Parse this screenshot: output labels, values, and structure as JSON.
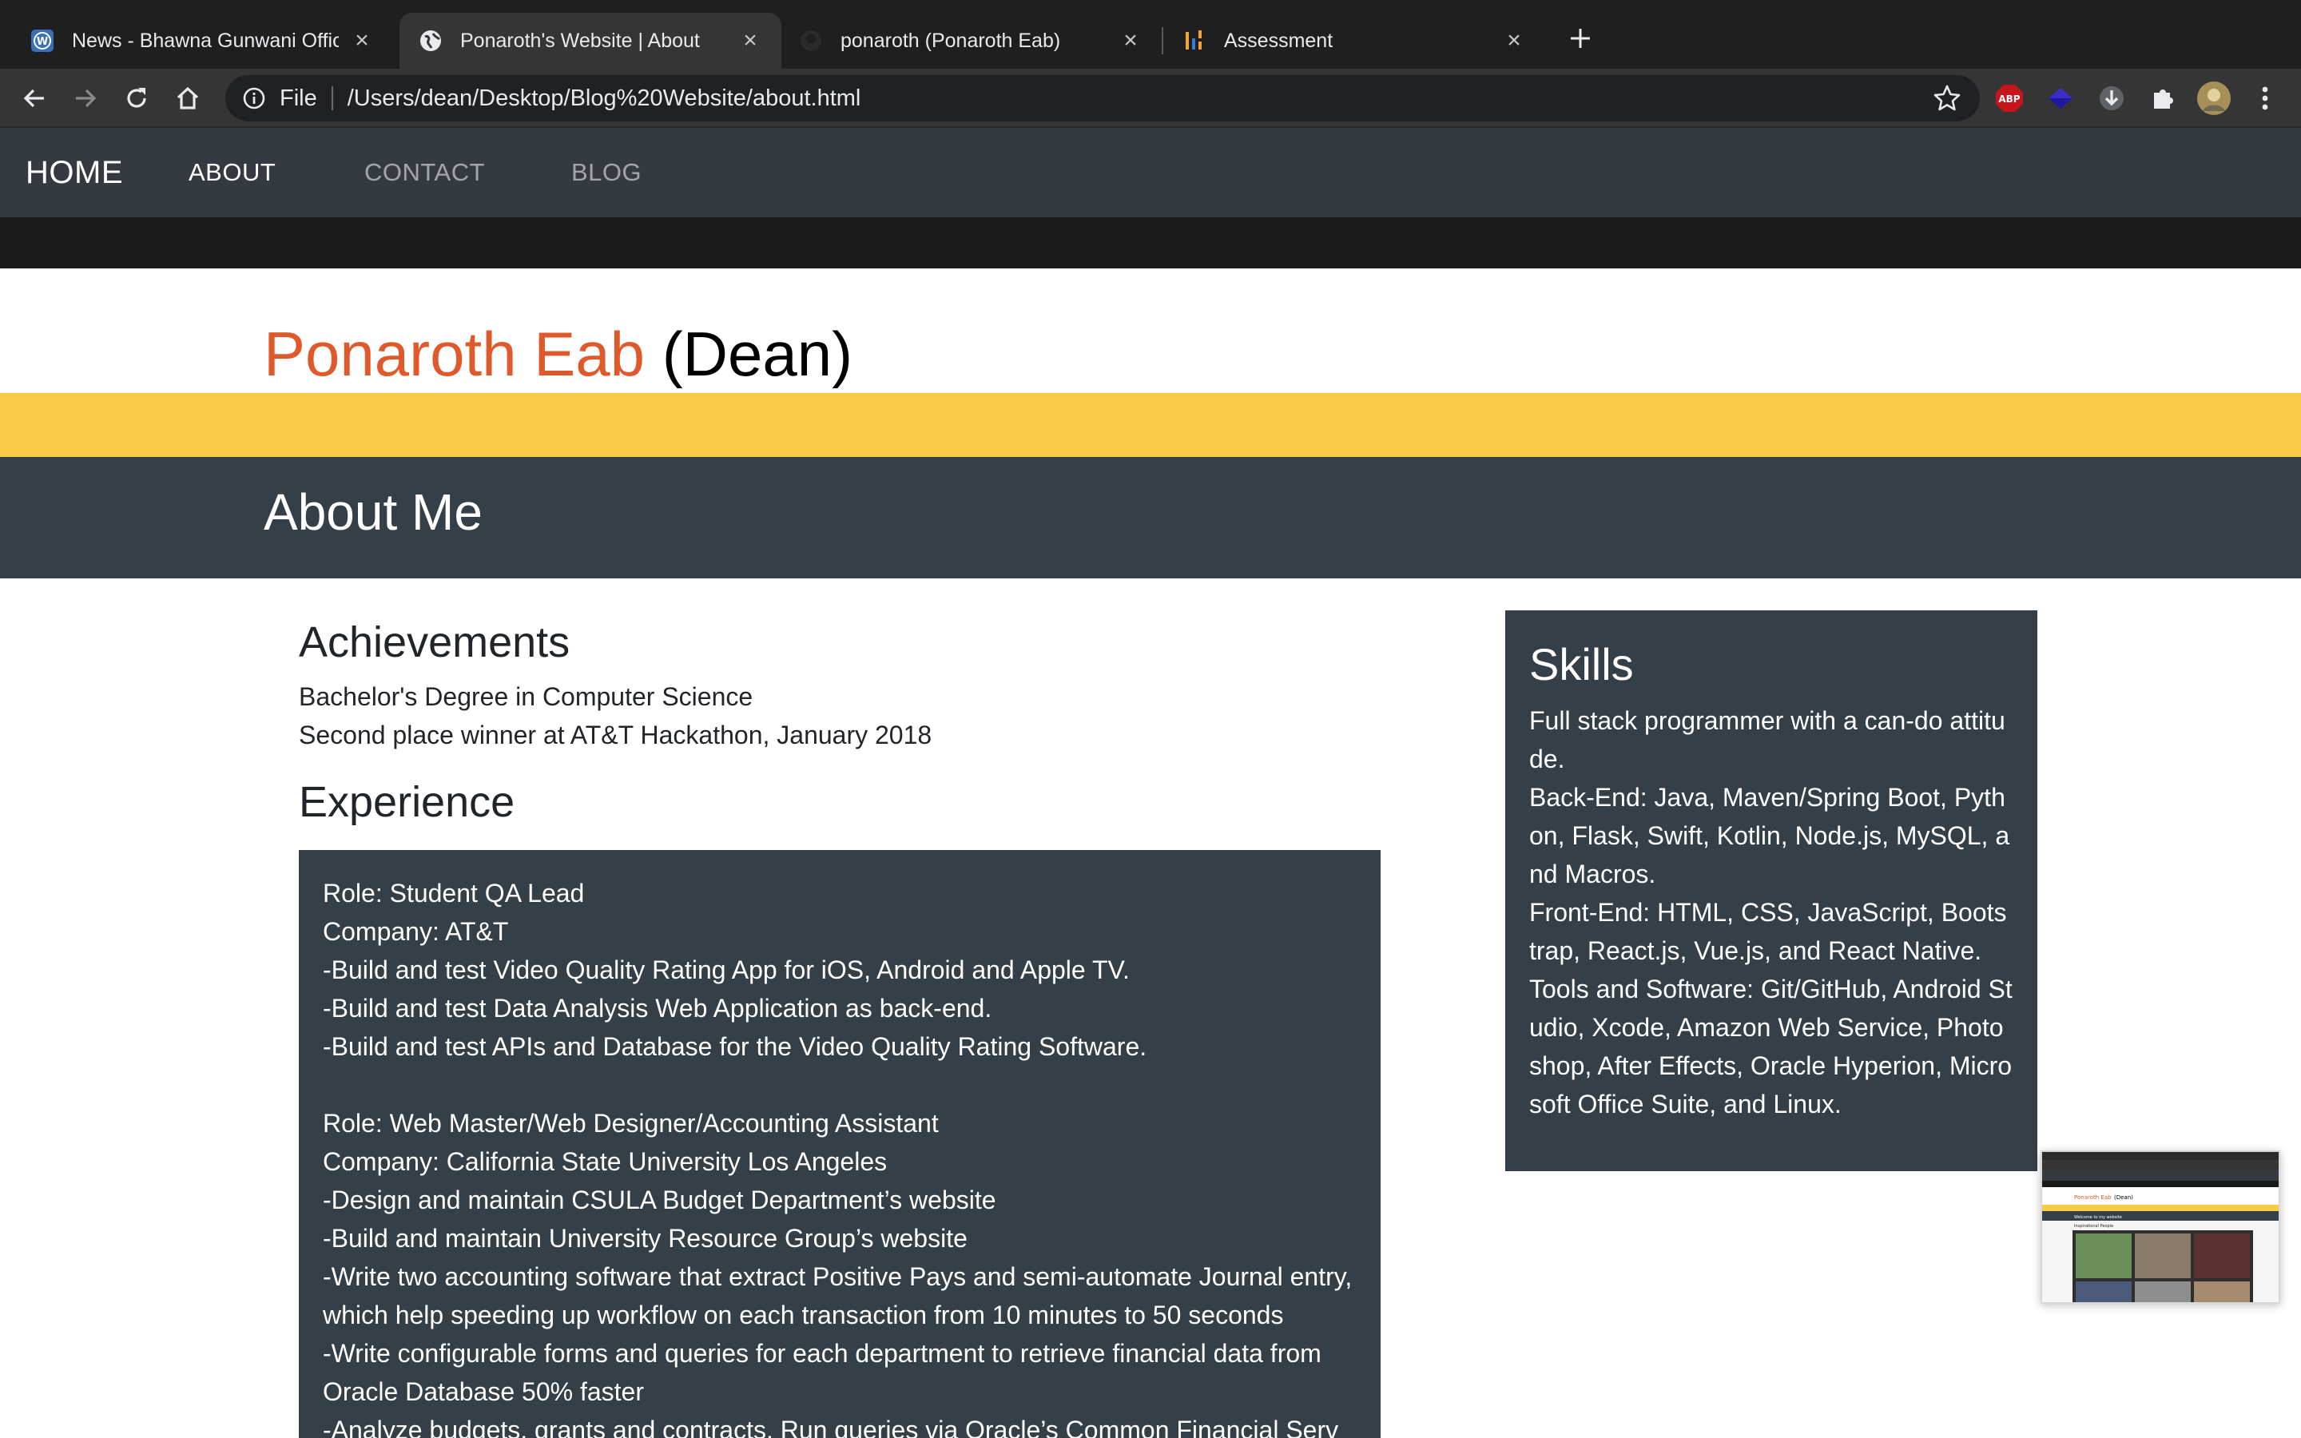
{
  "tabs": [
    {
      "title": "News - Bhawna Gunwani Offici",
      "favicon": "wordpress-icon",
      "active": false
    },
    {
      "title": "Ponaroth's Website | About",
      "favicon": "globe-icon",
      "active": true
    },
    {
      "title": "ponaroth (Ponaroth Eab)",
      "favicon": "github-icon",
      "active": false
    },
    {
      "title": "Assessment",
      "favicon": "assessment-icon",
      "active": false
    }
  ],
  "toolbar": {
    "scheme": "File",
    "url": "/Users/dean/Desktop/Blog%20Website/about.html"
  },
  "extensions": [
    "abp-icon",
    "gem-extension-icon",
    "download-extension-icon",
    "puzzle-icon",
    "profile-avatar"
  ],
  "nav": {
    "brand": "HOME",
    "links": [
      "ABOUT",
      "CONTACT",
      "BLOG"
    ],
    "active_link": "ABOUT"
  },
  "header": {
    "name": "Ponaroth Eab",
    "nickname": "(Dean)"
  },
  "colors": {
    "accent_name": "#e0592b",
    "yellow_band": "#f7cb46",
    "panel": "#343f48",
    "nav": "#343a40"
  },
  "about": {
    "title": "About Me"
  },
  "achievements": {
    "heading": "Achievements",
    "items": [
      "Bachelor's Degree in Computer Science",
      "Second place winner at AT&T Hackathon, January 2018"
    ]
  },
  "experience": {
    "heading": "Experience",
    "jobs": [
      {
        "role": "Role: Student QA Lead",
        "company": "Company: AT&T",
        "duties": [
          "-Build and test Video Quality Rating App for iOS, Android and Apple TV.",
          "-Build and test Data Analysis Web Application as back-end.",
          "-Build and test APIs and Database for the Video Quality Rating Software."
        ]
      },
      {
        "role": "Role: Web Master/Web Designer/Accounting Assistant",
        "company": "Company: California State University Los Angeles",
        "duties": [
          "-Design and maintain CSULA Budget Department’s website",
          "-Build and maintain University Resource Group’s website",
          "-Write two accounting software that extract Positive Pays and semi-automate Journal entry, which help speeding up workflow on each transaction from 10 minutes to 50 seconds",
          "-Write configurable forms and queries for each department to retrieve financial data from Oracle Database 50% faster",
          "-Analyze budgets, grants and contracts. Run queries via Oracle’s Common Financial Serv"
        ]
      }
    ]
  },
  "skills": {
    "heading": "Skills",
    "lines": [
      "Full stack programmer with a can-do attitude.",
      "Back-End: Java, Maven/Spring Boot, Python, Flask, Swift, Kotlin, Node.js, MySQL, and Macros.",
      "Front-End: HTML, CSS, JavaScript, Bootstrap, React.js, Vue.js, and React Native.",
      "Tools and Software: Git/GitHub, Android Studio, Xcode, Amazon Web Service, Photoshop, After Effects, Oracle Hyperion, Microsoft Office Suite, and Linux."
    ]
  },
  "pip": {
    "title_name": "Ponaroth Eab",
    "title_nick": "(Dean)",
    "welcome": "Welcome to my website",
    "subheading": "Inspirational People"
  }
}
